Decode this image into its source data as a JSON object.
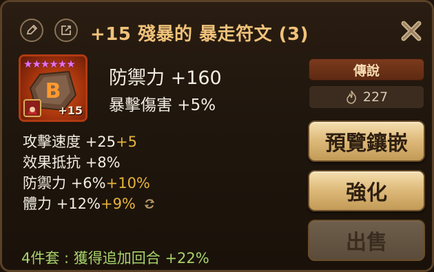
{
  "title": "+15 殘暴的 暴走符文 (3)",
  "rune": {
    "stars": "★★★★★★",
    "level": "+15",
    "glyph": "B"
  },
  "main_stat": "防禦力 +160",
  "prefix_stat": "暴擊傷害 +5%",
  "sub_stats": [
    {
      "name": "攻擊速度",
      "value": "+25",
      "bonus": "+5"
    },
    {
      "name": "效果抵抗",
      "value": "+8%",
      "bonus": ""
    },
    {
      "name": "防禦力",
      "value": "+6%",
      "bonus": "+10%"
    },
    {
      "name": "體力",
      "value": "+12%",
      "bonus": "+9%"
    }
  ],
  "set_effect": "4件套 : 獲得追加回合 +22%",
  "grade": "傳說",
  "sell_price": "227",
  "buttons": {
    "preview": "預覽鑲嵌",
    "enhance": "強化",
    "sell": "出售"
  },
  "icons": {
    "edit": "pencil-icon",
    "share": "share-icon",
    "close": "close-icon",
    "price": "flame-icon",
    "reapply": "cycle-icon"
  },
  "colors": {
    "title": "#f0c27a",
    "bonus": "#e8b33c",
    "set_effect": "#a8d36c",
    "stars": "#e472f0"
  }
}
